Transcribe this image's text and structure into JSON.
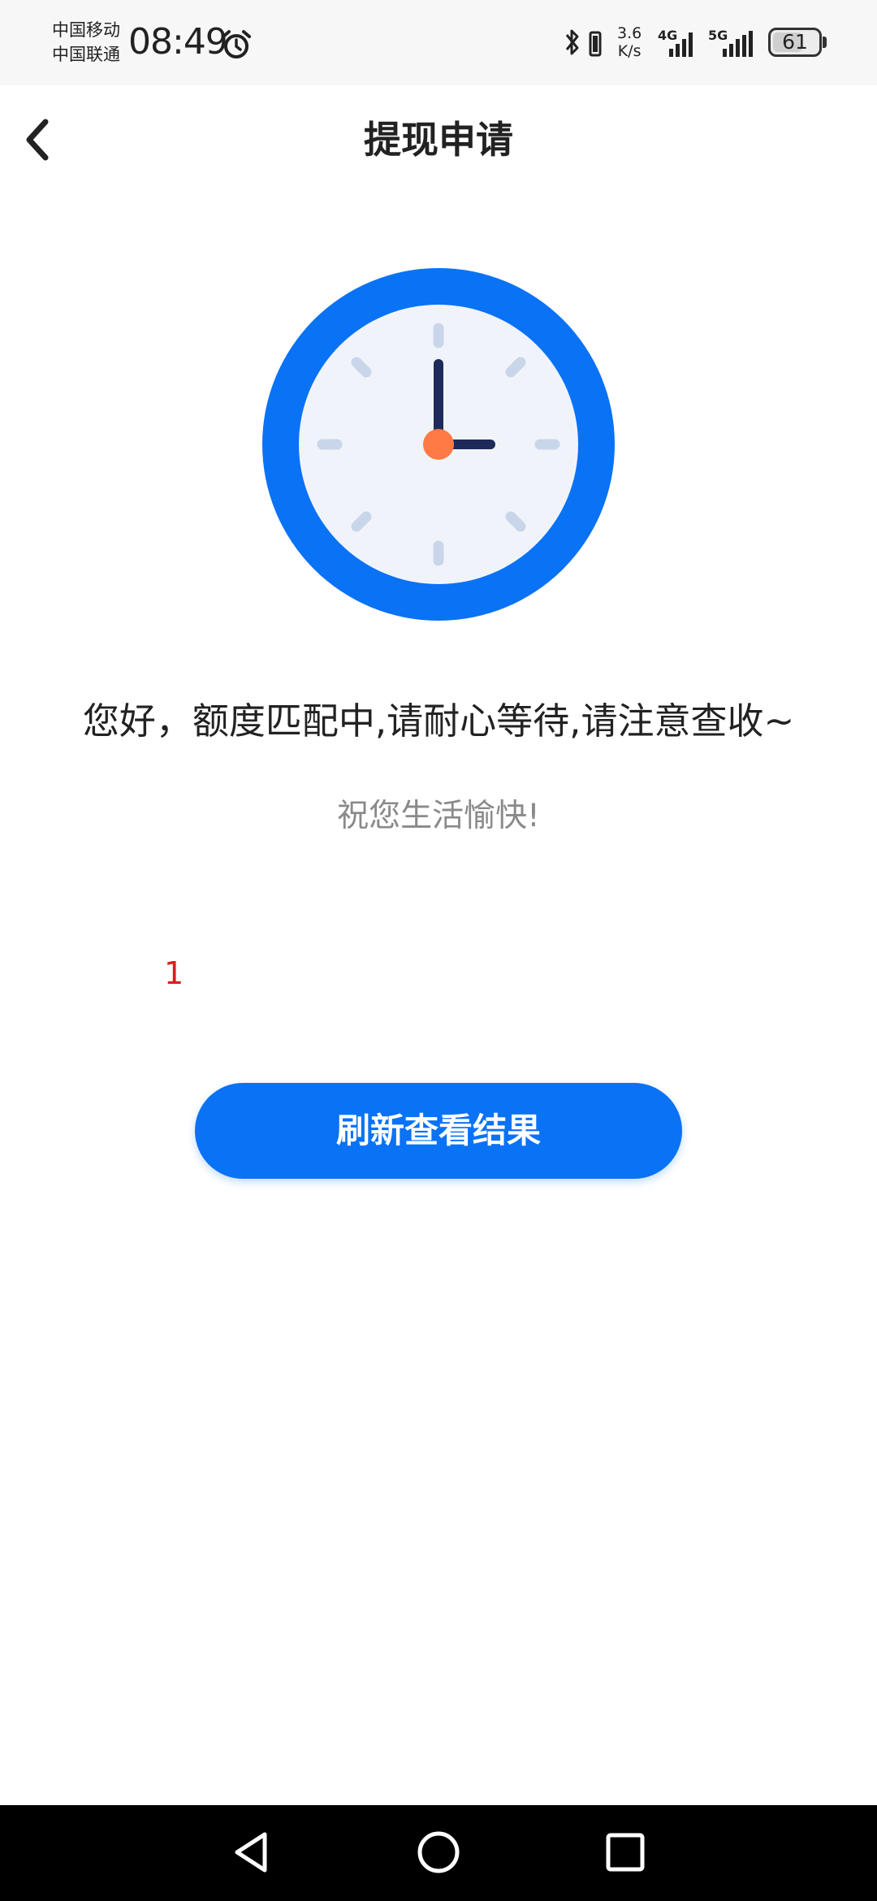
{
  "status_bar": {
    "carrier_1": "中国移动",
    "carrier_2": "中国联通",
    "time": "08:49",
    "net_speed_value": "3.6",
    "net_speed_unit": "K/s",
    "signal_4g_label": "4G",
    "signal_5g_label": "5G",
    "battery_level": "61",
    "icons": [
      "alarm-icon",
      "bluetooth-icon",
      "vibrate-icon",
      "signal-4g-icon",
      "signal-5g-icon",
      "battery-icon"
    ]
  },
  "header": {
    "title": "提现申请",
    "back_icon": "chevron-left-icon"
  },
  "content": {
    "illustration": "clock-icon",
    "message": "您好，额度匹配中,请耐心等待,请注意查收~",
    "wish": "祝您生活愉快!",
    "counter": "1",
    "counter_color": "#d81e1e"
  },
  "actions": {
    "refresh_label": "刷新查看结果",
    "primary_color": "#0a72f5"
  },
  "nav_bar": {
    "icons": [
      "nav-back-icon",
      "nav-home-icon",
      "nav-recent-icon"
    ]
  }
}
